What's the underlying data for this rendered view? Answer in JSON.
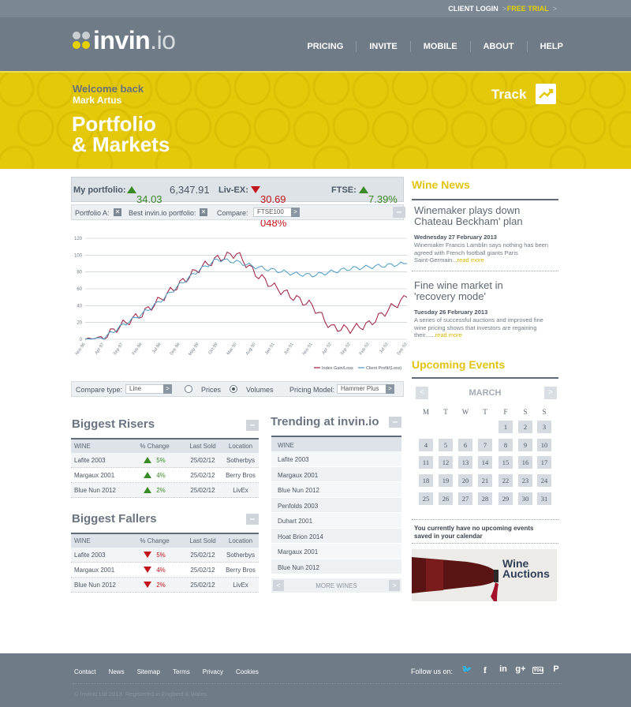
{
  "topbar": {
    "client_login": "CLIENT LOGIN",
    "free_trial": "FREE TRIAL",
    "chevron": ">"
  },
  "logo": {
    "name": "invin",
    "tld": ".io"
  },
  "nav": [
    "PRICING",
    "INVITE",
    "MOBILE",
    "ABOUT",
    "HELP"
  ],
  "banner": {
    "welcome": "Welcome back",
    "user": "Mark Artus",
    "title_line1": "Portfolio",
    "title_line2": "& Markets",
    "track": "Track"
  },
  "summary": {
    "portfolio_label": "My portfolio:",
    "portfolio_change": "34.03",
    "portfolio_value": "6,347.91",
    "livex_label": "Liv-EX:",
    "livex_value": "30.69 / 048%",
    "ftse_label": "FTSE:",
    "ftse_value": "7.39%"
  },
  "filters": {
    "portfolio_a": "Portfolio A:",
    "best": "Best invin.io portfolio:",
    "compare": "Compare:",
    "compare_value": "FTSE100",
    "x": "✕",
    "arrow": ">",
    "minus": "–"
  },
  "chart_data": {
    "type": "line",
    "x": [
      "Nov 96",
      "Apr 97",
      "Sep 97",
      "Feb 98",
      "Jul 98",
      "Dec 98",
      "May 99",
      "Oct 99",
      "Mar 00",
      "Aug 00",
      "Jan 01",
      "Jun 01",
      "Nov 01",
      "Apr 02",
      "Sep 02",
      "Feb 03",
      "Jul 03",
      "Dec 03"
    ],
    "yticks": [
      "0",
      "20",
      "40",
      "60",
      "80",
      "100",
      "120"
    ],
    "ylim": [
      0,
      120
    ],
    "series": [
      {
        "name": "Index Gain/Loss",
        "color": "#9b1c3c",
        "values": [
          0,
          3,
          18,
          30,
          48,
          66,
          84,
          96,
          102,
          78,
          62,
          50,
          40,
          14,
          12,
          18,
          35,
          50
        ]
      },
      {
        "name": "Client Profit/(Loss)",
        "color": "#4a9ac4",
        "values": [
          0,
          2,
          17,
          30,
          46,
          65,
          82,
          95,
          92,
          86,
          82,
          78,
          76,
          80,
          84,
          86,
          88,
          90
        ]
      }
    ],
    "grid": true,
    "legend": "bottom-right"
  },
  "compare_bar": {
    "type_label": "Compare type:",
    "type_value": "Line",
    "prices": "Prices",
    "volumes": "Volumes",
    "model_label": "Pricing Model:",
    "model_value": "Hammer Plus",
    "arrow": ">"
  },
  "risers": {
    "title": "Biggest Risers",
    "headers": [
      "WINE",
      "% Change",
      "Last Sold",
      "Location"
    ],
    "rows": [
      [
        "Lafite 2003",
        "5%",
        "25/02/12",
        "Sotherbys"
      ],
      [
        "Margaux 2001",
        "4%",
        "25/02/12",
        "Berry Bros"
      ],
      [
        "Blue Nun 2012",
        "2%",
        "25/02/12",
        "LivEx"
      ]
    ]
  },
  "fallers": {
    "title": "Biggest Fallers",
    "headers": [
      "WINE",
      "% Change",
      "Last Sold",
      "Location"
    ],
    "rows": [
      [
        "Lafite 2003",
        "5%",
        "25/02/12",
        "Sotherbys"
      ],
      [
        "Margaux 2001",
        "4%",
        "25/02/12",
        "Berry Bros"
      ],
      [
        "Blue Nun 2012",
        "2%",
        "25/02/12",
        "LivEx"
      ]
    ]
  },
  "trending": {
    "title": "Trending at invin.io",
    "header": "WINE",
    "items": [
      "Lafite 2003",
      "Margaux 2001",
      "Blue Nun 2012",
      "Penfolds 2003",
      "Duhart 2001",
      "Hoat Brion 2014",
      "Margaux 2001",
      "Blue Nun 2012"
    ],
    "more": "MORE WINES",
    "prev": "<",
    "next": ">"
  },
  "news": {
    "title": "Wine News",
    "items": [
      {
        "t1": "Winemaker plays down",
        "t2": "Chateau Beckham' plan",
        "date": "Wednesday 27 February 2013",
        "b1": "Winemaker Francis Lamblin says nothing has been",
        "b2": "agreed with French football giants Paris",
        "b3": "Saint-Germain...",
        "more": "read more"
      },
      {
        "t1": "Fine wine market in",
        "t2": "'recovery mode'",
        "date": "Tuesday 26 February 2013",
        "b1": "A series of successful auctions and improved fine",
        "b2": "wine pricing shows that investors are regaining",
        "b3": "their......",
        "more": "read more"
      }
    ]
  },
  "events": {
    "title": "Upcoming Events",
    "month": "MARCH",
    "prev": "<",
    "next": ">",
    "dow": [
      "M",
      "T",
      "W",
      "T",
      "F",
      "S",
      "S"
    ],
    "days": [
      "1",
      "2",
      "3",
      "4",
      "5",
      "6",
      "7",
      "8",
      "9",
      "10",
      "11",
      "12",
      "13",
      "14",
      "15",
      "16",
      "17",
      "18",
      "19",
      "20",
      "21",
      "22",
      "23",
      "24",
      "25",
      "26",
      "27",
      "28",
      "29",
      "30",
      "31"
    ],
    "none_line1": "You currently have no upcoming events",
    "none_line2": "saved in your calendar"
  },
  "auction": {
    "line1": "Wine",
    "line2": "Auctions"
  },
  "footer": {
    "links": [
      "Contact",
      "News",
      "Sitemap",
      "Terms",
      "Privacy",
      "Cookies"
    ],
    "follow": "Follow us on:",
    "social": [
      "🐦",
      "f",
      "in",
      "g+",
      "You",
      "P"
    ],
    "copyright": "© Invinio Ltd 2013. Registered in England & Wales"
  }
}
